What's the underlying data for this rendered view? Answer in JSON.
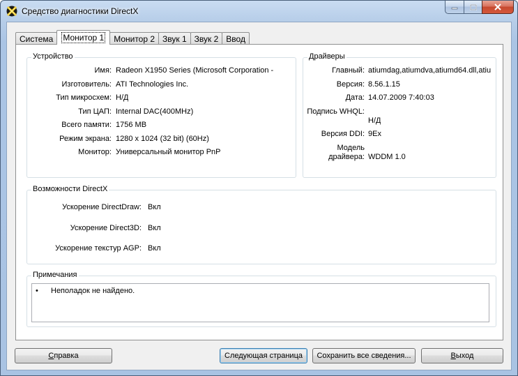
{
  "window": {
    "title": "Средство диагностики DirectX"
  },
  "tabs": [
    {
      "label": "Система",
      "active": false
    },
    {
      "label": "Монитор 1",
      "active": true
    },
    {
      "label": "Монитор 2",
      "active": false
    },
    {
      "label": "Звук 1",
      "active": false
    },
    {
      "label": "Звук 2",
      "active": false
    },
    {
      "label": "Ввод",
      "active": false
    }
  ],
  "device": {
    "title": "Устройство",
    "rows": [
      {
        "label": "Имя:",
        "value": "Radeon X1950 Series (Microsoft Corporation -"
      },
      {
        "label": "Изготовитель:",
        "value": "ATI Technologies Inc."
      },
      {
        "label": "Тип микросхем:",
        "value": "Н/Д"
      },
      {
        "label": "Тип ЦАП:",
        "value": "Internal DAC(400MHz)"
      },
      {
        "label": "Всего памяти:",
        "value": "1756 MB"
      },
      {
        "label": "Режим экрана:",
        "value": "1280 x 1024 (32 bit) (60Hz)"
      },
      {
        "label": "Монитор:",
        "value": "Универсальный монитор PnP"
      }
    ]
  },
  "drivers": {
    "title": "Драйверы",
    "main_label": "Главный:",
    "main_value": "atiumdag,atiumdva,atiumd64.dll,atiu",
    "version_label": "Версия:",
    "version_value": "8.56.1.15",
    "date_label": "Дата:",
    "date_value": "14.07.2009 7:40:03",
    "whql_label": "Подпись WHQL:",
    "whql_value": "Н/Д",
    "ddi_label": "Версия DDI:",
    "ddi_value": "9Ex",
    "model_label_1": "Модель",
    "model_label_2": "драйвера:",
    "model_value": "WDDM 1.0"
  },
  "directx": {
    "title": "Возможности DirectX",
    "rows": [
      {
        "label": "Ускорение DirectDraw:",
        "value": "Вкл"
      },
      {
        "label": "Ускорение Direct3D:",
        "value": "Вкл"
      },
      {
        "label": "Ускорение текстур AGP:",
        "value": "Вкл"
      }
    ]
  },
  "notes": {
    "title": "Примечания",
    "bullet": "•",
    "text": "Неполадок не найдено."
  },
  "buttons": {
    "help": {
      "pre": "",
      "accel": "С",
      "post": "правка"
    },
    "next": "Следующая страница",
    "save": "Сохранить все сведения...",
    "exit": {
      "pre": "",
      "accel": "В",
      "post": "ыход"
    }
  }
}
